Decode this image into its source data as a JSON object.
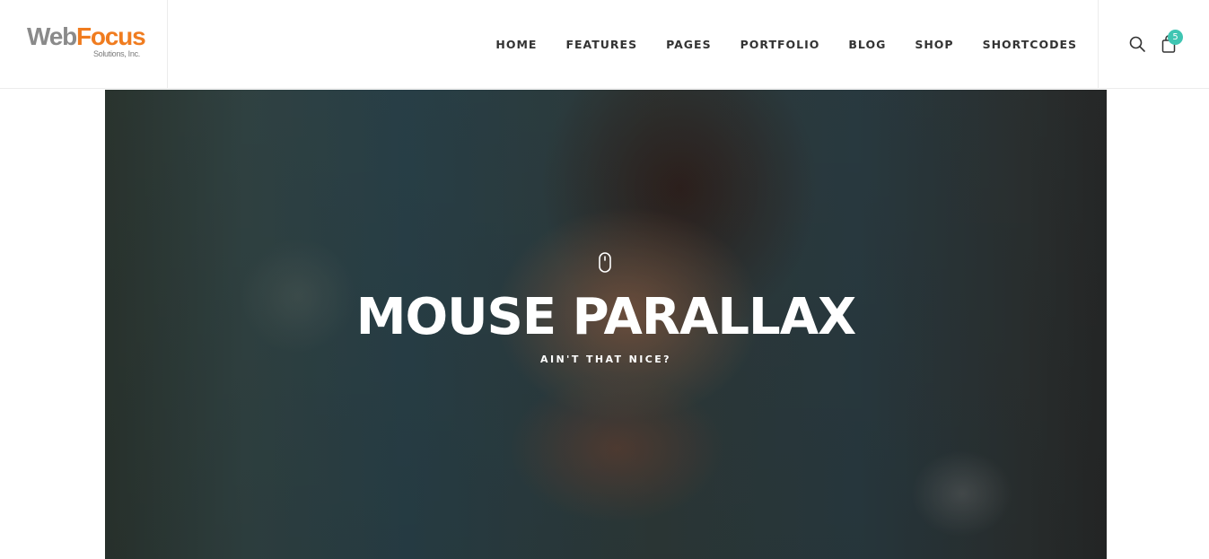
{
  "header": {
    "logo": {
      "word_1": "Web",
      "word_2": "Focus",
      "tagline": "Solutions, Inc."
    },
    "nav": [
      {
        "label": "HOME"
      },
      {
        "label": "FEATURES"
      },
      {
        "label": "PAGES"
      },
      {
        "label": "PORTFOLIO"
      },
      {
        "label": "BLOG"
      },
      {
        "label": "SHOP"
      },
      {
        "label": "SHORTCODES"
      }
    ],
    "tools": {
      "search_icon": "search-icon",
      "cart_icon": "shopping-bag-icon",
      "cart_count": "5"
    }
  },
  "hero": {
    "icon": "mouse-icon",
    "title": "MOUSE PARALLAX",
    "subtitle": "AIN'T THAT NICE?"
  },
  "colors": {
    "logo_gray": "#8a8a8a",
    "logo_orange": "#f07c1f",
    "nav_text": "#333333",
    "badge": "#3fc5b2",
    "hero_text": "#ffffff"
  }
}
